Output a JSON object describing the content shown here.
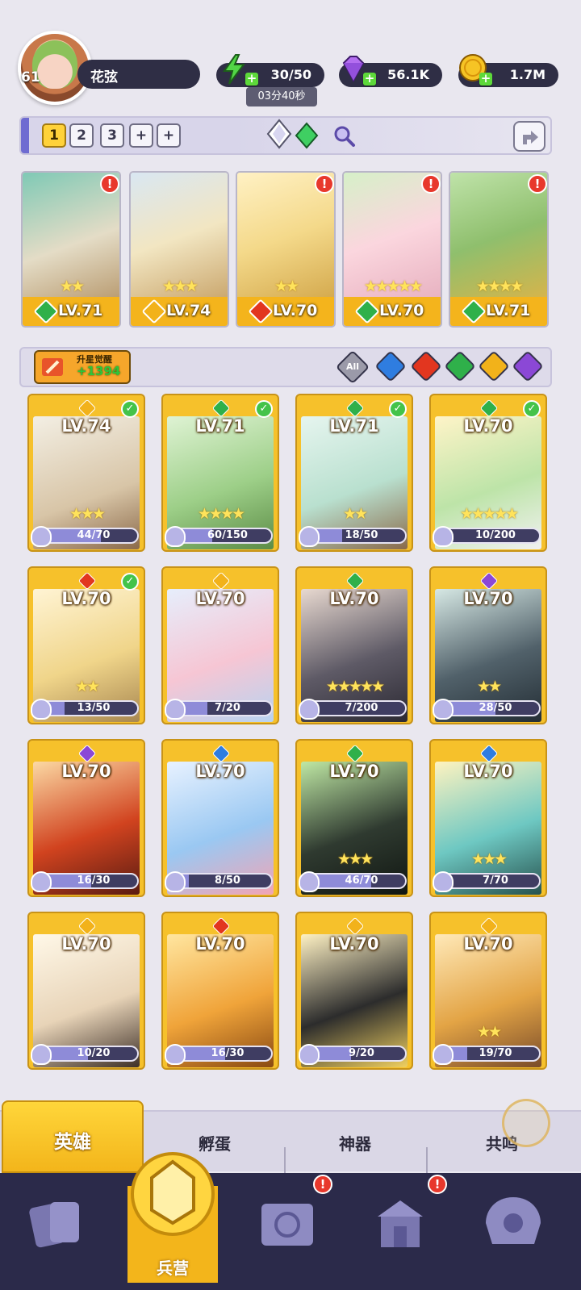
{
  "player": {
    "level": "61",
    "name": "花弦"
  },
  "resources": {
    "energy": "30/50",
    "energy_timer": "03分40秒",
    "gems": "56.1K",
    "gold": "1.7M"
  },
  "team_slots": [
    "1",
    "2",
    "3",
    "+",
    "+"
  ],
  "team_cards": [
    {
      "level": "LV.71",
      "stars": "★★",
      "element": "nature",
      "alert": "!"
    },
    {
      "level": "LV.74",
      "stars": "★★★",
      "element": "light",
      "alert": ""
    },
    {
      "level": "LV.70",
      "stars": "★★",
      "element": "fire",
      "alert": "!"
    },
    {
      "level": "LV.70",
      "stars": "★★★★★",
      "element": "nature",
      "alert": "!"
    },
    {
      "level": "LV.71",
      "stars": "★★★★",
      "element": "nature",
      "alert": "!"
    }
  ],
  "awaken": {
    "label": "升星觉醒",
    "value": "+1394"
  },
  "filters": {
    "all_label": "All",
    "elements": [
      "water",
      "fire",
      "nature",
      "light",
      "dark"
    ]
  },
  "heroes": [
    {
      "level": "LV.74",
      "element": "light",
      "checked": true,
      "stars": "★★★",
      "progress": "44/70"
    },
    {
      "level": "LV.71",
      "element": "nature",
      "checked": true,
      "stars": "★★★★",
      "progress": "60/150"
    },
    {
      "level": "LV.71",
      "element": "nature",
      "checked": true,
      "stars": "★★",
      "progress": "18/50"
    },
    {
      "level": "LV.70",
      "element": "nature",
      "checked": true,
      "stars": "★★★★★",
      "progress": "10/200"
    },
    {
      "level": "LV.70",
      "element": "fire",
      "checked": true,
      "stars": "★★",
      "progress": "13/50"
    },
    {
      "level": "LV.70",
      "element": "light",
      "checked": false,
      "stars": "",
      "progress": "7/20"
    },
    {
      "level": "LV.70",
      "element": "nature",
      "checked": false,
      "stars": "★★★★★",
      "progress": "7/200"
    },
    {
      "level": "LV.70",
      "element": "dark",
      "checked": false,
      "stars": "★★",
      "progress": "28/50"
    },
    {
      "level": "LV.70",
      "element": "dark",
      "checked": false,
      "stars": "",
      "progress": "16/30"
    },
    {
      "level": "LV.70",
      "element": "water",
      "checked": false,
      "stars": "",
      "progress": "8/50"
    },
    {
      "level": "LV.70",
      "element": "nature",
      "checked": false,
      "stars": "★★★",
      "progress": "46/70"
    },
    {
      "level": "LV.70",
      "element": "water",
      "checked": false,
      "stars": "★★★",
      "progress": "7/70"
    },
    {
      "level": "LV.70",
      "element": "light",
      "checked": false,
      "stars": "",
      "progress": "10/20"
    },
    {
      "level": "LV.70",
      "element": "fire",
      "checked": false,
      "stars": "",
      "progress": "16/30"
    },
    {
      "level": "LV.70",
      "element": "light",
      "checked": false,
      "stars": "",
      "progress": "9/20"
    },
    {
      "level": "LV.70",
      "element": "light",
      "checked": false,
      "stars": "★★",
      "progress": "19/70"
    }
  ],
  "tabs": [
    "英雄",
    "孵蛋",
    "神器",
    "共鸣"
  ],
  "nav": {
    "center_label": "兵营",
    "alerts": [
      "!",
      "!"
    ]
  },
  "colors": {
    "water": "#2f7de0",
    "fire": "#e2361f",
    "nature": "#2fb04a",
    "light": "#f2b21a",
    "dark": "#8b48d6",
    "accent": "#f4b41c",
    "nav": "#2b2a4a"
  }
}
